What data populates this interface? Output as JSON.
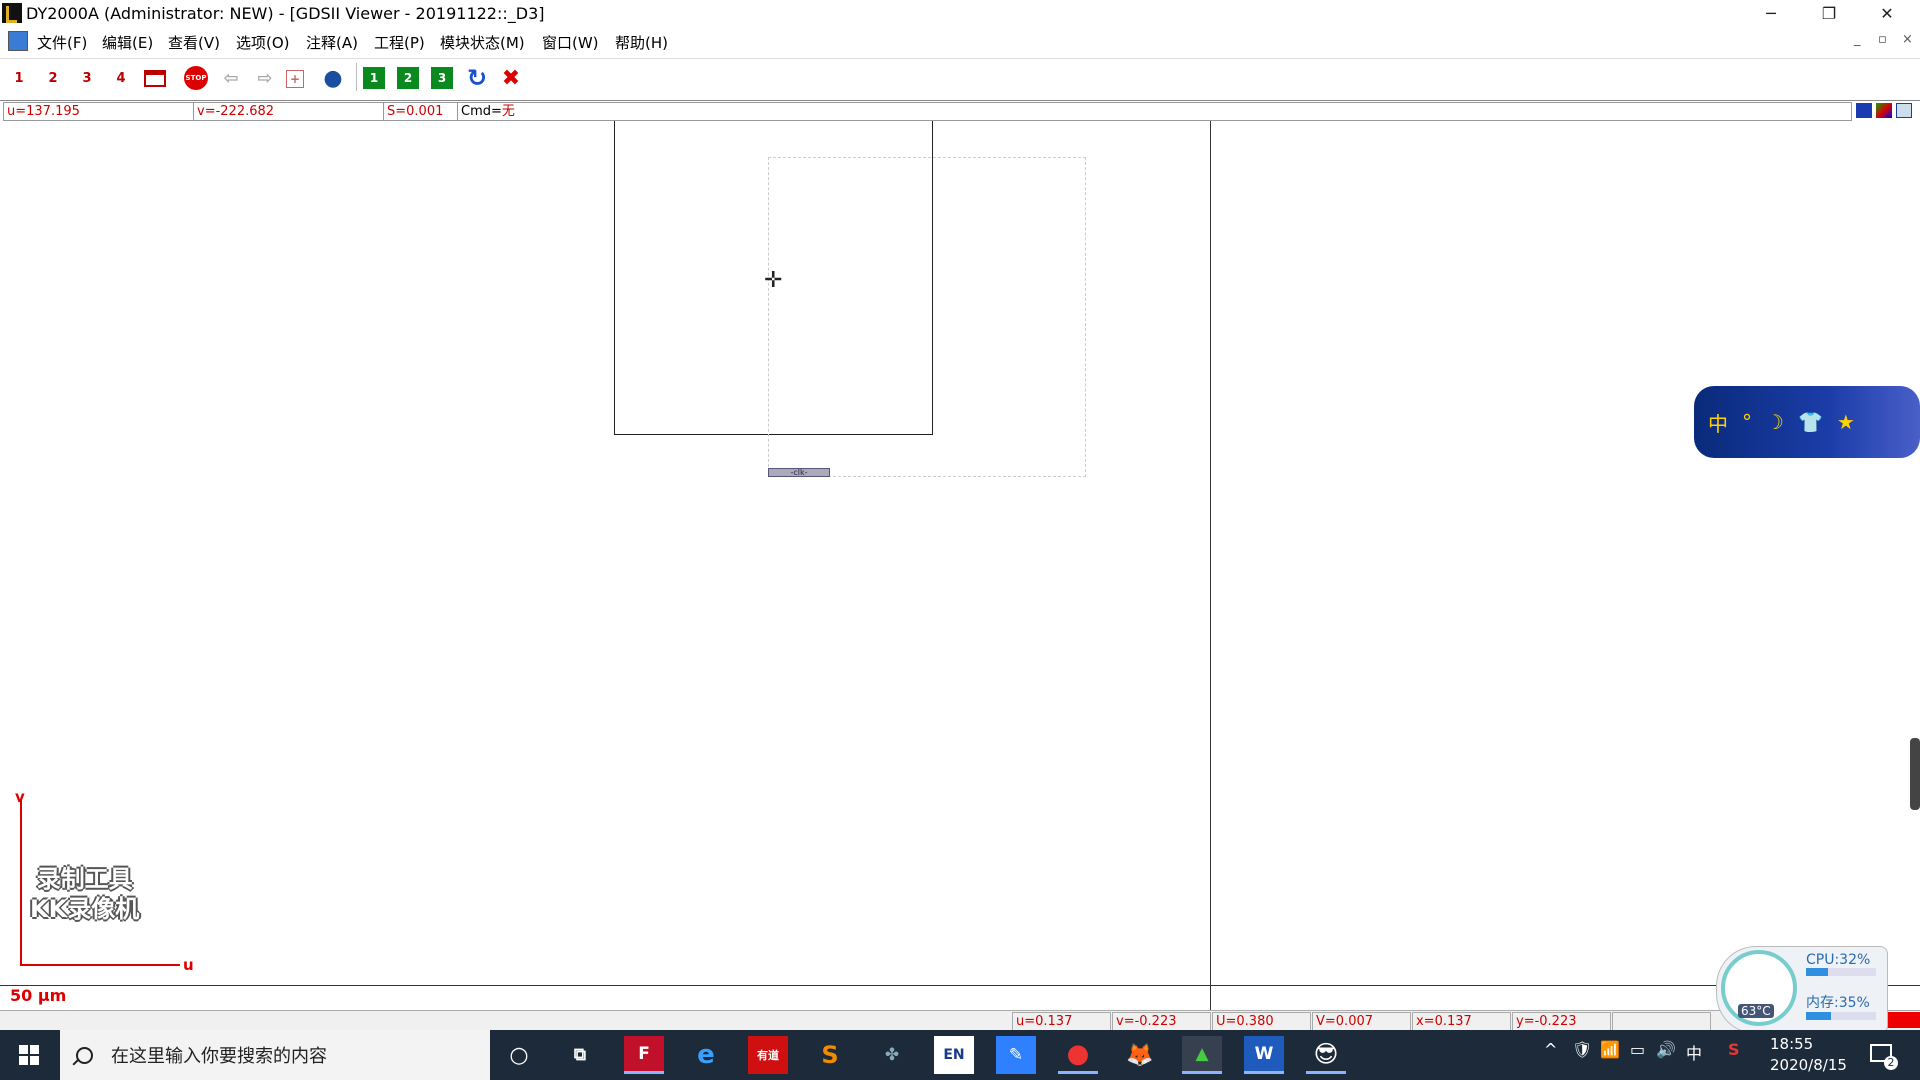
{
  "window": {
    "title": "DY2000A (Administrator: NEW) - [GDSII Viewer - 20191122::_D3]",
    "minimize": "─",
    "restore": "❐",
    "close": "✕"
  },
  "menubar": {
    "items": [
      "文件(F)",
      "编辑(E)",
      "查看(V)",
      "选项(O)",
      "注释(A)",
      "工程(P)",
      "模块状态(M)",
      "窗口(W)",
      "帮助(H)"
    ],
    "mdi_buttons": [
      "_",
      "▫",
      "×"
    ]
  },
  "toolbar": {
    "buttons": [
      {
        "name": "screen-1",
        "label": "1"
      },
      {
        "name": "screen-2",
        "label": "2"
      },
      {
        "name": "screen-3",
        "label": "3"
      },
      {
        "name": "screen-4",
        "label": "4"
      },
      {
        "name": "screen-5",
        "label": ""
      },
      {
        "name": "stop",
        "label": "STOP"
      },
      {
        "name": "back",
        "label": "⇦"
      },
      {
        "name": "forward",
        "label": "⇨"
      },
      {
        "name": "zoom-box",
        "label": "+"
      },
      {
        "name": "globe",
        "label": "●"
      },
      {
        "name": "flag-1",
        "label": "1"
      },
      {
        "name": "flag-2",
        "label": "2"
      },
      {
        "name": "flag-3",
        "label": "3"
      },
      {
        "name": "refresh",
        "label": "↻"
      },
      {
        "name": "cancel",
        "label": "✖"
      }
    ]
  },
  "coords": {
    "u": "u=137.195",
    "v": "v=-222.682",
    "s": "S=0.001",
    "cmd_prefix": "Cmd=",
    "cmd_value": "无"
  },
  "canvas": {
    "small_label": "-clk-",
    "axis_v": "v",
    "axis_u": "u",
    "scale": "50 μm",
    "watermark_line1": "录制工具",
    "watermark_line2": "KK录像机",
    "widget_chars": [
      "中",
      "°",
      "☽",
      "👕",
      "★"
    ]
  },
  "statusbar": {
    "fields": [
      "u=0.137",
      "v=-0.223",
      "U=0.380",
      "V=0.007",
      "x=0.137",
      "y=-0.223"
    ]
  },
  "monitor": {
    "cpu": "CPU:32%",
    "cpu_value": 0.32,
    "mem": "内存:35%",
    "mem_value": 0.35,
    "temp": "63°C"
  },
  "taskbar": {
    "search_placeholder": "在这里输入你要搜索的内容",
    "apps": [
      "F",
      "e",
      "有道",
      "S",
      "✤",
      "EN",
      "✎",
      "●",
      "🦊",
      "▲",
      "W",
      "😎"
    ],
    "tray_icons": [
      "^",
      "🛡",
      "📶",
      "▭",
      "🔊",
      "中",
      "S"
    ],
    "time": "18:55",
    "date": "2020/8/15",
    "notifications": "2"
  },
  "colors": {
    "coord_text": "#d00000",
    "accent": "#1c2a3a"
  }
}
